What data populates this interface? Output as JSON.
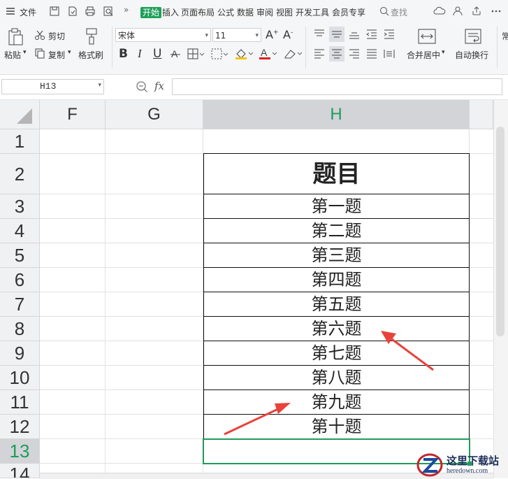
{
  "menu": {
    "file": "文件",
    "tabs": [
      "开始",
      "插入",
      "页面布局",
      "公式",
      "数据",
      "审阅",
      "视图",
      "开发工具",
      "会员专享"
    ],
    "search": "查找",
    "more": "»"
  },
  "ribbon": {
    "cut": "剪切",
    "paste": "粘贴",
    "copy": "复制",
    "format_painter": "格式刷",
    "font_name": "宋体",
    "font_size": "11",
    "bold": "B",
    "italic": "I",
    "underline": "U",
    "merge_center": "合并居中",
    "wrap_text": "自动换行",
    "overflow": "常"
  },
  "formula_bar": {
    "name_box": "H13",
    "fx": "fx",
    "content": ""
  },
  "sheet": {
    "columns": [
      "F",
      "G",
      "H"
    ],
    "rows": [
      "1",
      "2",
      "3",
      "4",
      "5",
      "6",
      "7",
      "8",
      "9",
      "10",
      "11",
      "12",
      "13",
      "14"
    ],
    "header_cell": "题目",
    "items": [
      "第一题",
      "第二题",
      "第三题",
      "第四题",
      "第五题",
      "第六题",
      "第七题",
      "第八题",
      "第九题",
      "第十题"
    ],
    "selected_cell": "H13"
  },
  "watermark": {
    "text": "这里下载站",
    "url": "heredown.com"
  },
  "colors": {
    "accent": "#1fa05a",
    "arrow": "#e8423b",
    "selection": "#1f9c5c"
  }
}
